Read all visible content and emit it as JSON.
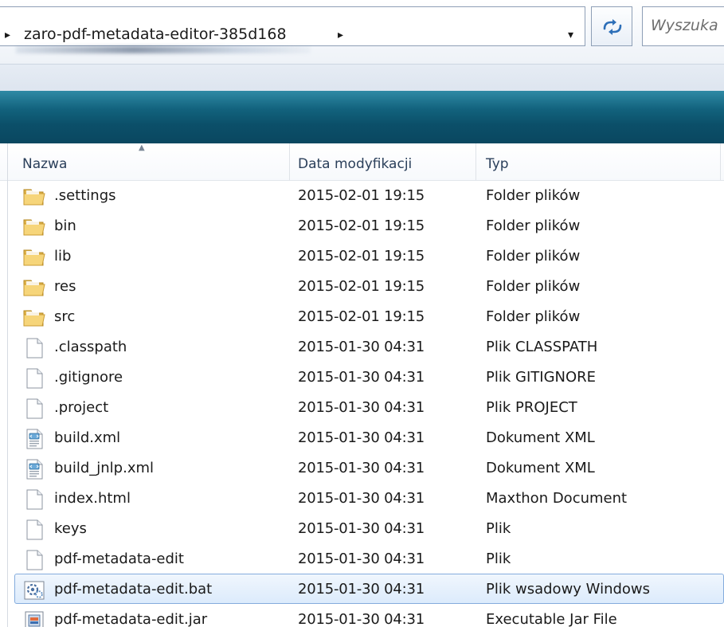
{
  "address_bar": {
    "breadcrumb": "zaro-pdf-metadata-editor-385d168",
    "left_arrow": "▸",
    "right_arrow": "▸",
    "dropdown_arrow": "▾"
  },
  "search": {
    "placeholder": "Wyszuka"
  },
  "columns": {
    "name": "Nazwa",
    "date": "Data modyfikacji",
    "type": "Typ",
    "sort_indicator": "▲"
  },
  "files": [
    {
      "icon": "folder-icon",
      "name": ".settings",
      "date": "2015-02-01 19:15",
      "type": "Folder plików"
    },
    {
      "icon": "folder-icon",
      "name": "bin",
      "date": "2015-02-01 19:15",
      "type": "Folder plików"
    },
    {
      "icon": "folder-icon",
      "name": "lib",
      "date": "2015-02-01 19:15",
      "type": "Folder plików"
    },
    {
      "icon": "folder-icon",
      "name": "res",
      "date": "2015-02-01 19:15",
      "type": "Folder plików"
    },
    {
      "icon": "folder-icon",
      "name": "src",
      "date": "2015-02-01 19:15",
      "type": "Folder plików"
    },
    {
      "icon": "file-icon",
      "name": ".classpath",
      "date": "2015-01-30 04:31",
      "type": "Plik CLASSPATH"
    },
    {
      "icon": "file-icon",
      "name": ".gitignore",
      "date": "2015-01-30 04:31",
      "type": "Plik GITIGNORE"
    },
    {
      "icon": "file-icon",
      "name": ".project",
      "date": "2015-01-30 04:31",
      "type": "Plik PROJECT"
    },
    {
      "icon": "xml-file-icon",
      "name": "build.xml",
      "date": "2015-01-30 04:31",
      "type": "Dokument XML"
    },
    {
      "icon": "xml-file-icon",
      "name": "build_jnlp.xml",
      "date": "2015-01-30 04:31",
      "type": "Dokument XML"
    },
    {
      "icon": "file-icon",
      "name": "index.html",
      "date": "2015-01-30 04:31",
      "type": "Maxthon Document"
    },
    {
      "icon": "file-icon",
      "name": "keys",
      "date": "2015-01-30 04:31",
      "type": "Plik"
    },
    {
      "icon": "file-icon",
      "name": "pdf-metadata-edit",
      "date": "2015-01-30 04:31",
      "type": "Plik"
    },
    {
      "icon": "batch-file-icon",
      "name": "pdf-metadata-edit.bat",
      "date": "2015-01-30 04:31",
      "type": "Plik wsadowy Windows",
      "selected": true
    },
    {
      "icon": "jar-file-icon",
      "name": "pdf-metadata-edit.jar",
      "date": "2015-01-30 04:31",
      "type": "Executable Jar File"
    }
  ],
  "colors": {
    "teal_band": "#0b4f69",
    "selection_border": "#84acdd",
    "selection_fill": "#dcebfc",
    "header_text": "#2a3f5a"
  }
}
